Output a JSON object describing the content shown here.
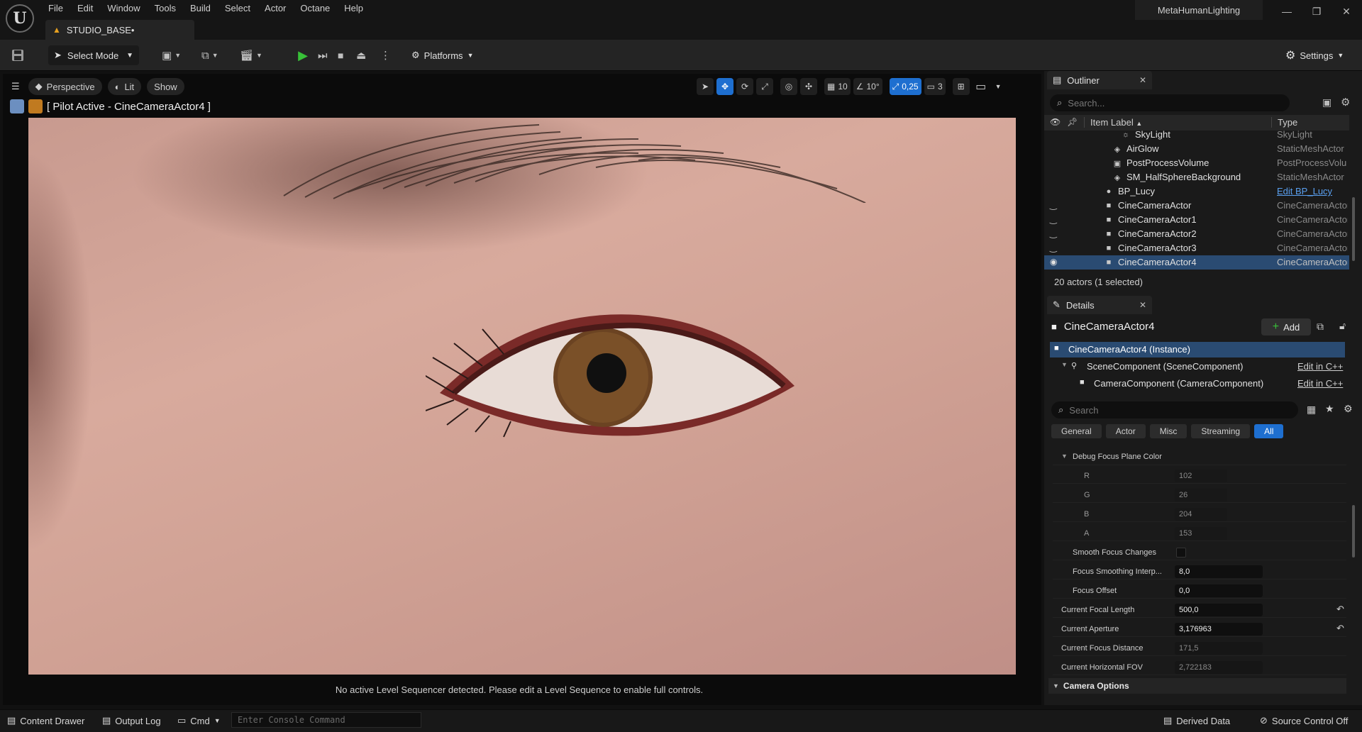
{
  "menu": [
    "File",
    "Edit",
    "Window",
    "Tools",
    "Build",
    "Select",
    "Actor",
    "Octane",
    "Help"
  ],
  "doc_tab": "STUDIO_BASE•",
  "app_name": "MetaHumanLighting",
  "toolbar": {
    "select_mode": "Select Mode",
    "platforms": "Platforms",
    "settings": "Settings"
  },
  "viewport": {
    "perspective": "Perspective",
    "lit": "Lit",
    "show": "Show",
    "grid_snap": "10",
    "rot_snap": "10°",
    "scale_snap": "0,25",
    "cam_speed": "3",
    "pilot": "[ Pilot Active - CineCameraActor4 ]",
    "sequencer_msg": "No active Level Sequencer detected. Please edit a Level Sequence to enable full controls."
  },
  "outliner": {
    "tab": "Outliner",
    "search_placeholder": "Search...",
    "col_label": "Item Label",
    "col_type": "Type",
    "rows": [
      {
        "label": "SkyLight",
        "type": "SkyLight"
      },
      {
        "label": "AirGlow",
        "type": "StaticMeshActor"
      },
      {
        "label": "PostProcessVolume",
        "type": "PostProcessVolu"
      },
      {
        "label": "SM_HalfSphereBackground",
        "type": "StaticMeshActor"
      },
      {
        "label": "BP_Lucy",
        "type": "Edit BP_Lucy"
      },
      {
        "label": "CineCameraActor",
        "type": "CineCameraActor"
      },
      {
        "label": "CineCameraActor1",
        "type": "CineCameraActor"
      },
      {
        "label": "CineCameraActor2",
        "type": "CineCameraActor"
      },
      {
        "label": "CineCameraActor3",
        "type": "CineCameraActor"
      },
      {
        "label": "CineCameraActor4",
        "type": "CineCameraActor"
      }
    ],
    "count": "20 actors (1 selected)"
  },
  "details": {
    "tab": "Details",
    "actor": "CineCameraActor4",
    "add": "Add",
    "components": [
      {
        "label": "CineCameraActor4 (Instance)",
        "edit": ""
      },
      {
        "label": "SceneComponent (SceneComponent)",
        "edit": "Edit in C++"
      },
      {
        "label": "CameraComponent (CameraComponent)",
        "edit": "Edit in C++"
      }
    ],
    "search_placeholder": "Search",
    "filters": [
      "General",
      "Actor",
      "Misc",
      "Streaming",
      "All"
    ],
    "props": {
      "debug_color": "Debug Focus Plane Color",
      "r_label": "R",
      "r": "102",
      "g_label": "G",
      "g": "26",
      "b_label": "B",
      "b": "204",
      "a_label": "A",
      "a": "153",
      "smooth": "Smooth Focus Changes",
      "smoothing_label": "Focus Smoothing Interp...",
      "smoothing": "8,0",
      "offset_label": "Focus Offset",
      "offset": "0,0",
      "focal_label": "Current Focal Length",
      "focal": "500,0",
      "aperture_label": "Current Aperture",
      "aperture": "3,176963",
      "focus_dist_label": "Current Focus Distance",
      "focus_dist": "171,5",
      "hfov_label": "Current Horizontal FOV",
      "hfov": "2,722183"
    },
    "camera_options": "Camera Options"
  },
  "statusbar": {
    "content_drawer": "Content Drawer",
    "output_log": "Output Log",
    "cmd": "Cmd",
    "console_placeholder": "Enter Console Command",
    "derived_data": "Derived Data",
    "source_control": "Source Control Off"
  },
  "colors": {
    "accent": "#1e6fd0",
    "selection": "#2a4b72",
    "play": "#38c038",
    "debug_focus": "#661accfd"
  }
}
